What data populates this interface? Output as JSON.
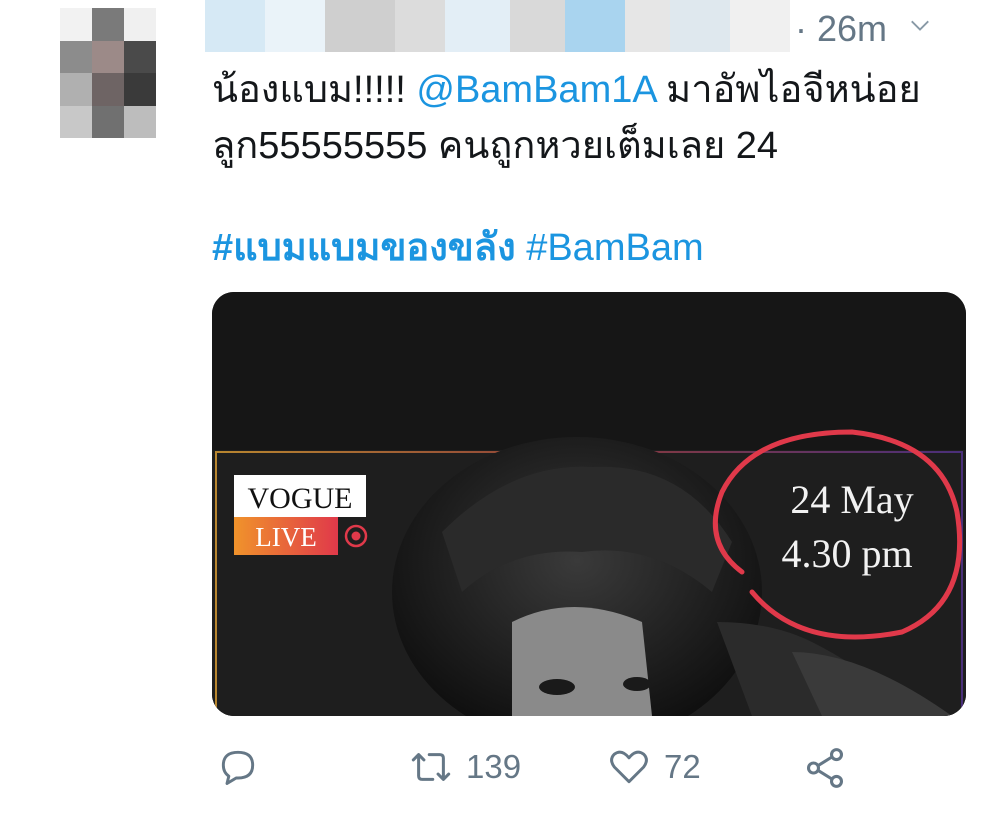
{
  "tweet": {
    "timestamp": "· 26m",
    "text_before_mention": "น้องแบม!!!!! ",
    "mention": "@BamBam1A",
    "text_after_mention": " มาอัพไอจีหน่อยลูก55555555 คนถูกหวยเต็มเลย 24",
    "hashtags": [
      "#แบมแบมของขลัง",
      "#BamBam"
    ]
  },
  "media": {
    "vogue_label": "VOGUE",
    "live_label": "LIVE",
    "date_text": "24 May",
    "time_text": "4.30 pm",
    "accent_circle_color": "#e0394a",
    "live_gradient": [
      "#f0932b",
      "#e0394a"
    ]
  },
  "actions": {
    "reply_icon": "reply-icon",
    "retweet_icon": "retweet-icon",
    "retweet_count": "139",
    "like_icon": "heart-icon",
    "like_count": "72",
    "share_icon": "share-icon"
  },
  "colors": {
    "link": "#1b95e0",
    "meta": "#657786",
    "text": "#14171a"
  }
}
